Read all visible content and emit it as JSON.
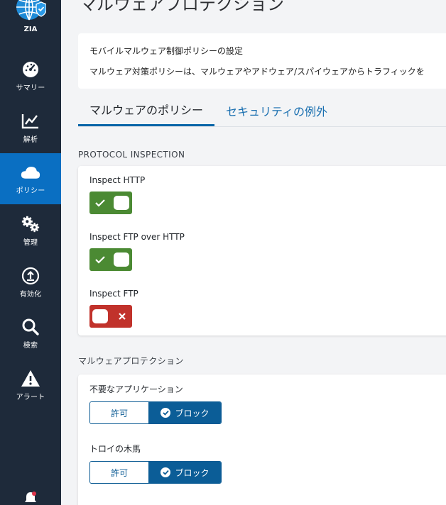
{
  "sidebar": {
    "logo_label": "ZIA",
    "items": [
      {
        "label": "サマリー",
        "icon": "gauge-icon"
      },
      {
        "label": "解析",
        "icon": "line-chart-icon"
      },
      {
        "label": "ポリシー",
        "icon": "cloud-icon"
      },
      {
        "label": "管理",
        "icon": "gears-icon"
      },
      {
        "label": "有効化",
        "icon": "upload-circle-icon"
      },
      {
        "label": "検索",
        "icon": "search-icon"
      },
      {
        "label": "アラート",
        "icon": "warning-icon"
      }
    ],
    "active_index": 2,
    "bottom_icon": "bell-icon"
  },
  "page": {
    "title": "マルウェアプロテクション"
  },
  "info": {
    "heading": "モバイルマルウェア制御ポリシーの設定",
    "description": "マルウェア対策ポリシーは、マルウェアやアドウェア/スパイウェアからトラフィックを"
  },
  "tabs": [
    {
      "label": "マルウェアのポリシー",
      "active": true
    },
    {
      "label": "セキュリティの例外",
      "active": false
    }
  ],
  "protocol_inspection": {
    "heading": "PROTOCOL INSPECTION",
    "items": [
      {
        "label": "Inspect HTTP",
        "enabled": true
      },
      {
        "label": "Inspect FTP over HTTP",
        "enabled": true
      },
      {
        "label": "Inspect FTP",
        "enabled": false
      }
    ]
  },
  "malware_protection": {
    "heading": "マルウェアプロテクション",
    "allow_label": "許可",
    "block_label": "ブロック",
    "items": [
      {
        "label": "不要なアプリケーション",
        "selected": "block"
      },
      {
        "label": "トロイの木馬",
        "selected": "block"
      }
    ]
  },
  "colors": {
    "sidebar_bg": "#1e2a3a",
    "active_nav": "#0a6fc2",
    "toggle_on": "#4b8a33",
    "toggle_off": "#c1322b",
    "segment_selected": "#0b5d97",
    "tab_link": "#1a6fb0"
  }
}
